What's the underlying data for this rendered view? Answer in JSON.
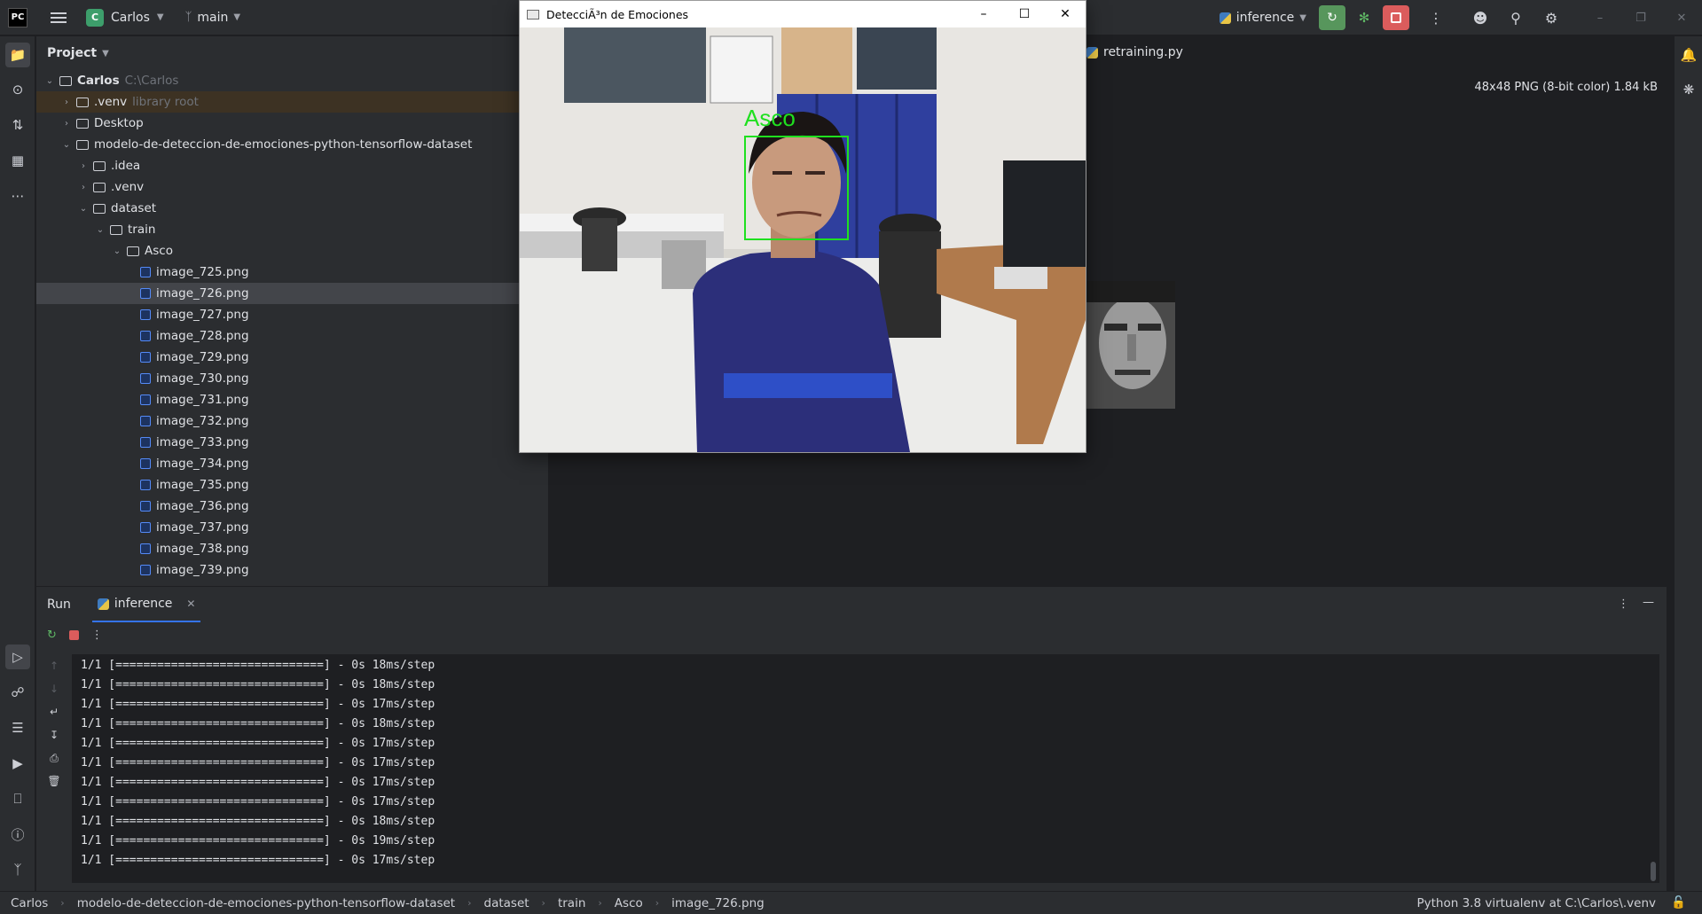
{
  "titlebar": {
    "project_name": "Carlos",
    "project_badge": "C",
    "branch": "main",
    "run_config": "inference"
  },
  "project_panel": {
    "title": "Project",
    "tree": [
      {
        "label": "Carlos",
        "hint": "C:\\Carlos",
        "type": "folder",
        "depth": 0,
        "expanded": true
      },
      {
        "label": ".venv",
        "hint": "library root",
        "type": "folder",
        "depth": 1,
        "expanded": false
      },
      {
        "label": "Desktop",
        "hint": "",
        "type": "folder",
        "depth": 1,
        "expanded": false
      },
      {
        "label": "modelo-de-deteccion-de-emociones-python-tensorflow-dataset",
        "hint": "",
        "type": "folder",
        "depth": 1,
        "expanded": true
      },
      {
        "label": ".idea",
        "hint": "",
        "type": "folder",
        "depth": 2,
        "expanded": false
      },
      {
        "label": ".venv",
        "hint": "",
        "type": "folder",
        "depth": 2,
        "expanded": false
      },
      {
        "label": "dataset",
        "hint": "",
        "type": "folder",
        "depth": 2,
        "expanded": true
      },
      {
        "label": "train",
        "hint": "",
        "type": "folder",
        "depth": 3,
        "expanded": true
      },
      {
        "label": "Asco",
        "hint": "",
        "type": "folder",
        "depth": 4,
        "expanded": true
      },
      {
        "label": "image_725.png",
        "hint": "",
        "type": "image",
        "depth": 5
      },
      {
        "label": "image_726.png",
        "hint": "",
        "type": "image",
        "depth": 5,
        "selected": true
      },
      {
        "label": "image_727.png",
        "hint": "",
        "type": "image",
        "depth": 5
      },
      {
        "label": "image_728.png",
        "hint": "",
        "type": "image",
        "depth": 5
      },
      {
        "label": "image_729.png",
        "hint": "",
        "type": "image",
        "depth": 5
      },
      {
        "label": "image_730.png",
        "hint": "",
        "type": "image",
        "depth": 5
      },
      {
        "label": "image_731.png",
        "hint": "",
        "type": "image",
        "depth": 5
      },
      {
        "label": "image_732.png",
        "hint": "",
        "type": "image",
        "depth": 5
      },
      {
        "label": "image_733.png",
        "hint": "",
        "type": "image",
        "depth": 5
      },
      {
        "label": "image_734.png",
        "hint": "",
        "type": "image",
        "depth": 5
      },
      {
        "label": "image_735.png",
        "hint": "",
        "type": "image",
        "depth": 5
      },
      {
        "label": "image_736.png",
        "hint": "",
        "type": "image",
        "depth": 5
      },
      {
        "label": "image_737.png",
        "hint": "",
        "type": "image",
        "depth": 5
      },
      {
        "label": "image_738.png",
        "hint": "",
        "type": "image",
        "depth": 5
      },
      {
        "label": "image_739.png",
        "hint": "",
        "type": "image",
        "depth": 5
      }
    ]
  },
  "editor": {
    "tab_label": "retraining.py",
    "image_info": "48x48 PNG (8-bit color) 1.84 kB"
  },
  "run_panel": {
    "title": "Run",
    "tab_label": "inference",
    "lines": [
      "1/1 [==============================] - 0s 18ms/step",
      "1/1 [==============================] - 0s 18ms/step",
      "1/1 [==============================] - 0s 17ms/step",
      "1/1 [==============================] - 0s 18ms/step",
      "1/1 [==============================] - 0s 17ms/step",
      "1/1 [==============================] - 0s 17ms/step",
      "1/1 [==============================] - 0s 17ms/step",
      "1/1 [==============================] - 0s 17ms/step",
      "1/1 [==============================] - 0s 18ms/step",
      "1/1 [==============================] - 0s 19ms/step",
      "1/1 [==============================] - 0s 17ms/step"
    ]
  },
  "statusbar": {
    "breadcrumb": [
      "Carlos",
      "modelo-de-deteccion-de-emociones-python-tensorflow-dataset",
      "dataset",
      "train",
      "Asco",
      "image_726.png"
    ],
    "interpreter": "Python 3.8 virtualenv at C:\\Carlos\\.venv"
  },
  "cv_window": {
    "title": "DetecciÃ³n de Emociones",
    "detected_label": "Asco",
    "box_color": "#1fe01f"
  },
  "colors": {
    "accent": "#3574f0",
    "run_green": "#57965c",
    "stop_red": "#db5c5c"
  }
}
